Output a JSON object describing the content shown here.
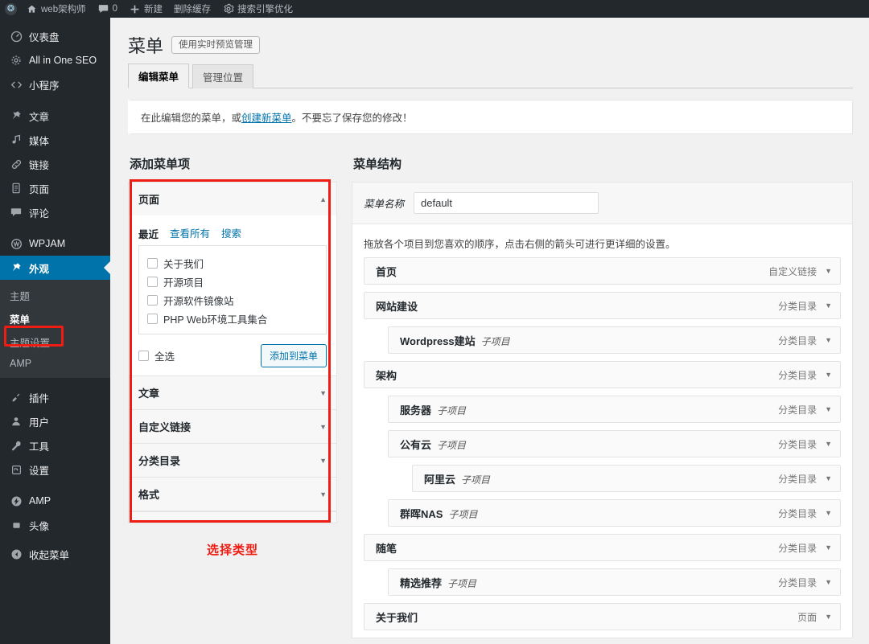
{
  "adminbar": {
    "items": [
      {
        "icon": "wordpress-logo-icon",
        "label": ""
      },
      {
        "icon": "home-icon",
        "label": "web架构师"
      },
      {
        "icon": "comment-icon",
        "label": "0"
      },
      {
        "icon": "plus-icon",
        "label": "新建"
      },
      {
        "icon": "",
        "label": "删除缓存"
      },
      {
        "icon": "gear-icon",
        "label": "搜索引擎优化"
      }
    ]
  },
  "sidebar": {
    "groups": [
      {
        "items": [
          {
            "icon": "dashboard-icon",
            "label": "仪表盘",
            "glyph": "▨"
          },
          {
            "icon": "gear-icon",
            "label": "All in One SEO",
            "glyph": "✲"
          },
          {
            "icon": "code-icon",
            "label": "小程序",
            "glyph": "<>"
          }
        ]
      },
      {
        "items": [
          {
            "icon": "pin-icon",
            "label": "文章",
            "glyph": "✎"
          },
          {
            "icon": "media-icon",
            "label": "媒体",
            "glyph": "♫"
          },
          {
            "icon": "link-icon",
            "label": "链接",
            "glyph": "🔗"
          },
          {
            "icon": "page-icon",
            "label": "页面",
            "glyph": "▤"
          },
          {
            "icon": "comment-icon",
            "label": "评论",
            "glyph": "💬"
          }
        ]
      },
      {
        "items": [
          {
            "icon": "wpjam-icon",
            "label": "WPJAM",
            "glyph": "◍"
          }
        ]
      }
    ],
    "current": {
      "icon": "appearance-icon",
      "label": "外观",
      "glyph": "✎"
    },
    "submenu": [
      {
        "label": "主题",
        "current": false
      },
      {
        "label": "菜单",
        "current": true
      },
      {
        "label": "主题设置",
        "current": false
      },
      {
        "label": "AMP",
        "current": false
      }
    ],
    "after": [
      {
        "icon": "plugin-icon",
        "label": "插件",
        "glyph": "🔌"
      },
      {
        "icon": "users-icon",
        "label": "用户",
        "glyph": "👤"
      },
      {
        "icon": "tools-icon",
        "label": "工具",
        "glyph": "🔧"
      },
      {
        "icon": "settings-icon",
        "label": "设置",
        "glyph": "⚙"
      }
    ],
    "tail": [
      {
        "icon": "amp-icon",
        "label": "AMP",
        "glyph": "⚡"
      },
      {
        "icon": "avatar-icon",
        "label": "头像",
        "glyph": "▪"
      }
    ],
    "collapse": {
      "icon": "collapse-icon",
      "label": "收起菜单",
      "glyph": "◀"
    }
  },
  "page": {
    "title": "菜单",
    "live_preview_button": "使用实时预览管理",
    "tabs": [
      {
        "label": "编辑菜单",
        "active": true
      },
      {
        "label": "管理位置",
        "active": false
      }
    ],
    "notice_before": "在此编辑您的菜单，或",
    "notice_link": "创建新菜单",
    "notice_after": "。不要忘了保存您的修改！"
  },
  "add_items": {
    "heading": "添加菜单项",
    "annotation": "选择类型",
    "pages_panel": {
      "title": "页面",
      "caret": "▲",
      "tabs": [
        {
          "label": "最近",
          "active": true
        },
        {
          "label": "查看所有",
          "active": false
        },
        {
          "label": "搜索",
          "active": false
        }
      ],
      "checkboxes": [
        {
          "label": "关于我们",
          "checked": false
        },
        {
          "label": "开源项目",
          "checked": false
        },
        {
          "label": "开源软件镜像站",
          "checked": false
        },
        {
          "label": "PHP Web环境工具集合",
          "checked": false
        }
      ],
      "select_all": "全选",
      "add_button": "添加到菜单"
    },
    "collapsed_panels": [
      {
        "title": "文章",
        "caret": "▼"
      },
      {
        "title": "自定义链接",
        "caret": "▼"
      },
      {
        "title": "分类目录",
        "caret": "▼"
      },
      {
        "title": "格式",
        "caret": "▼"
      }
    ]
  },
  "structure": {
    "heading": "菜单结构",
    "name_label": "菜单名称",
    "name_value": "default",
    "name_placeholder": "菜单名称",
    "hint": "拖放各个项目到您喜欢的顺序，点击右侧的箭头可进行更详细的设置。",
    "sub_item_label": "子项目",
    "caret": "▼",
    "items": [
      {
        "title": "首页",
        "sub": "",
        "type": "自定义链接",
        "depth": 0
      },
      {
        "title": "网站建设",
        "sub": "",
        "type": "分类目录",
        "depth": 0
      },
      {
        "title": "Wordpress建站",
        "sub": "子项目",
        "type": "分类目录",
        "depth": 1
      },
      {
        "title": "架构",
        "sub": "",
        "type": "分类目录",
        "depth": 0
      },
      {
        "title": "服务器",
        "sub": "子项目",
        "type": "分类目录",
        "depth": 1
      },
      {
        "title": "公有云",
        "sub": "子项目",
        "type": "分类目录",
        "depth": 1
      },
      {
        "title": "阿里云",
        "sub": "子项目",
        "type": "分类目录",
        "depth": 2
      },
      {
        "title": "群晖NAS",
        "sub": "子项目",
        "type": "分类目录",
        "depth": 1
      },
      {
        "title": "随笔",
        "sub": "",
        "type": "分类目录",
        "depth": 0
      },
      {
        "title": "精选推荐",
        "sub": "子项目",
        "type": "分类目录",
        "depth": 1
      },
      {
        "title": "关于我们",
        "sub": "",
        "type": "页面",
        "depth": 0
      }
    ]
  },
  "colors": {
    "sidebar_bg": "#23282d",
    "submenu_bg": "#32373c",
    "accent_blue": "#0073aa",
    "annotation_red": "#ee1c12",
    "content_bg": "#f1f1f1"
  }
}
